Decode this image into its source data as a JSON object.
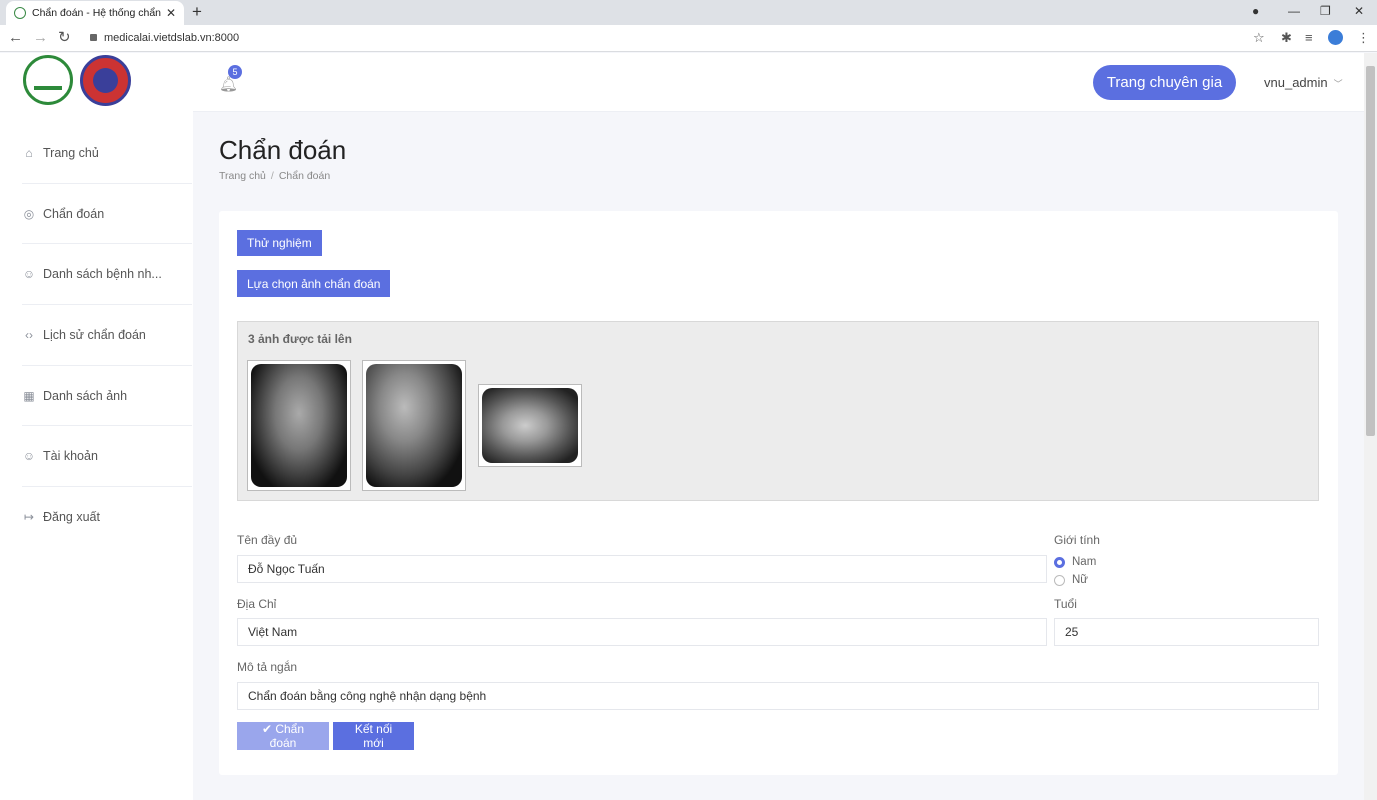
{
  "browser": {
    "tab_title": "Chẩn đoán - Hệ thống chẩn đoán",
    "tab_close": "✕",
    "new_tab": "+",
    "url": "medicalai.vietdslab.vn:8000"
  },
  "sidebar": {
    "items": [
      {
        "label": "Trang chủ",
        "icon": "home-icon",
        "glyph": "⌂"
      },
      {
        "label": "Chẩn đoán",
        "icon": "target-icon",
        "glyph": "◎"
      },
      {
        "label": "Danh sách bệnh nh...",
        "icon": "users-icon",
        "glyph": "☺"
      },
      {
        "label": "Lịch sử chẩn đoán",
        "icon": "code-icon",
        "glyph": "‹›"
      },
      {
        "label": "Danh sách ảnh",
        "icon": "grid-icon",
        "glyph": "▦"
      },
      {
        "label": "Tài khoản",
        "icon": "user-icon",
        "glyph": "☺"
      },
      {
        "label": "Đăng xuất",
        "icon": "logout-icon",
        "glyph": "↦"
      }
    ]
  },
  "header": {
    "notification_count": "5",
    "expert_button": "Trang chuyên gia",
    "username": "vnu_admin"
  },
  "page": {
    "title": "Chẩn đoán",
    "breadcrumb": [
      "Trang chủ",
      "Chẩn đoán"
    ]
  },
  "actions": {
    "test_button": "Thử nghiệm",
    "choose_image_button": "Lựa chọn ảnh chẩn đoán"
  },
  "upload": {
    "title": "3 ảnh được tải lên"
  },
  "form": {
    "full_name_label": "Tên đầy đủ",
    "full_name_value": "Đỗ Ngọc Tuấn",
    "gender_label": "Giới tính",
    "gender_options": [
      "Nam",
      "Nữ"
    ],
    "gender_selected": "Nam",
    "address_label": "Địa Chỉ",
    "address_value": "Việt Nam",
    "age_label": "Tuổi",
    "age_value": "25",
    "description_label": "Mô tả ngắn",
    "description_value": "Chẩn đoán bằng công nghệ nhận dạng bệnh",
    "diagnose_button": "✔ Chẩn đoán",
    "new_connection_button": "Kết nối mới"
  },
  "colors": {
    "accent": "#5b6fe0",
    "accent_light": "#9aa6ec"
  }
}
